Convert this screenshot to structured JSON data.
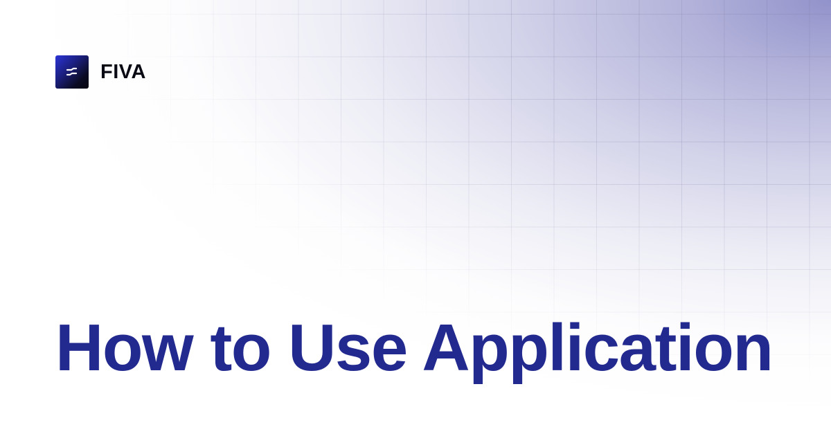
{
  "brand": {
    "name": "FIVA",
    "logo_icon": "fiva-logo-icon"
  },
  "headline": "How to Use Application",
  "colors": {
    "headline": "#232a8f",
    "brand_text": "#0a0a14",
    "gradient_accent": "#8c8cc8",
    "logo_start": "#2b34d6",
    "logo_end": "#050510"
  }
}
